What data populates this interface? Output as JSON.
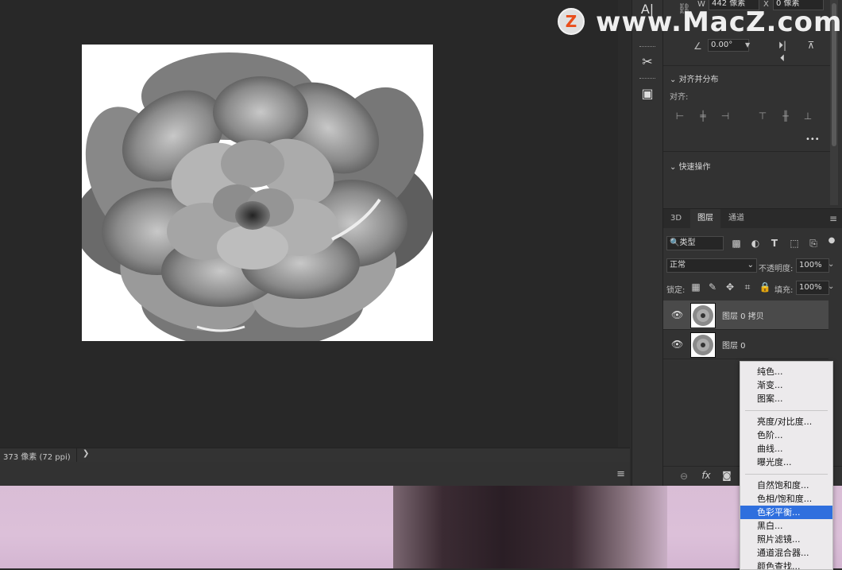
{
  "canvas": {
    "status_text": "373 像素 (72 ppi)",
    "status_chevron": "❯"
  },
  "properties": {
    "w_label": "W",
    "w_value": "442 像素",
    "x_label": "X",
    "x_value": "0 像素",
    "angle_value": "0.00°",
    "align_section_title": "对齐并分布",
    "align_label": "对齐:",
    "more": "•••",
    "quick_actions_title": "快速操作"
  },
  "layers_panel": {
    "tabs": [
      "3D",
      "图层",
      "通道"
    ],
    "filter_kind": "类型",
    "blend_mode": "正常",
    "opacity_label": "不透明度:",
    "opacity_value": "100%",
    "lock_label": "锁定:",
    "fill_label": "填充:",
    "fill_value": "100%",
    "layers": [
      {
        "name": "图层 0 拷贝",
        "selected": true
      },
      {
        "name": "图层 0",
        "selected": false
      }
    ]
  },
  "adjustment_menu": {
    "groups": [
      [
        "纯色...",
        "渐变...",
        "图案..."
      ],
      [
        "亮度/对比度...",
        "色阶...",
        "曲线...",
        "曝光度..."
      ],
      [
        "自然饱和度...",
        "色相/饱和度...",
        "色彩平衡...",
        "黑白...",
        "照片滤镜...",
        "通道混合器...",
        "颜色查找..."
      ]
    ],
    "highlighted": "色彩平衡..."
  },
  "watermark": {
    "logo_letter": "Z",
    "text": "www.MacZ.com"
  },
  "colors": {
    "panel_bg": "#323232",
    "canvas_bg": "#282828",
    "menu_highlight": "#2f6fde",
    "photo_bg": "#dcc0d9"
  }
}
